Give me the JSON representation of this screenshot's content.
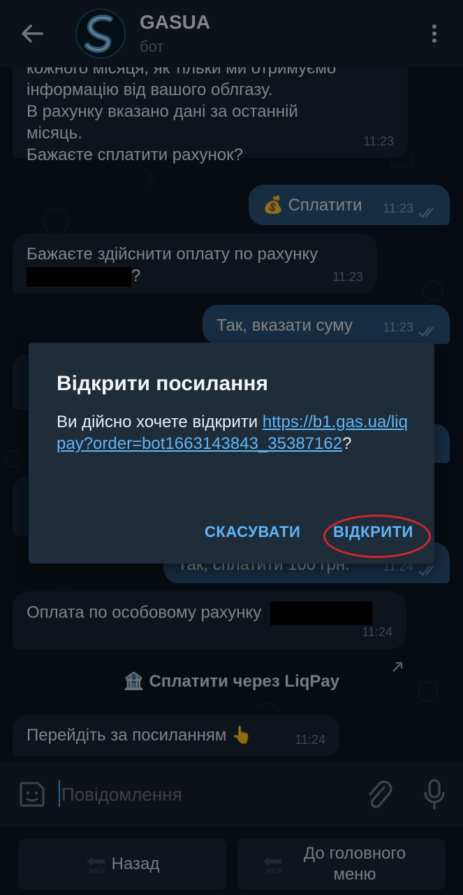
{
  "header": {
    "title": "GASUA",
    "subtitle": "бот"
  },
  "messages": [
    {
      "text_lines": [
        "кожного місяця, як тільки ми отримуємо",
        "інформацію від вашого облгазу.",
        "В рахунку вказано дані за останній",
        "місяць.",
        "Бажаєте сплатити рахунок?"
      ],
      "time": "11:23"
    },
    {
      "emoji": "💰",
      "text": "Сплатити",
      "time": "11:23"
    },
    {
      "text": "Бажаєте здійснити оплату по рахунку",
      "suffix": "?",
      "time": "11:23"
    },
    {
      "text": "Так, вказати суму",
      "time": "11:23"
    },
    {
      "text": "Так, сплатити 100 грн.",
      "time": "11:24"
    },
    {
      "text": "Оплата по особовому рахунку",
      "time": "11:24"
    },
    {
      "text": "Перейдіть за посиланням",
      "emoji": "👆",
      "time": "11:24"
    }
  ],
  "inline_button": {
    "emoji": "🏦",
    "label": "Сплатити через LiqPay"
  },
  "dialog": {
    "title": "Відкрити посилання",
    "question": "Ви дійсно хочете відкрити ",
    "link": "https://b1.gas.ua/liqpay?order=bot1663143843_35387162",
    "question_end": "?",
    "cancel": "СКАСУВАТИ",
    "open": "ВІДКРИТИ"
  },
  "composer": {
    "placeholder": "Повідомлення"
  },
  "keyboard": {
    "back": "Назад",
    "home": "До головного меню",
    "back_icon_text": "BACK"
  },
  "colors": {
    "header_bg": "#17212b",
    "chat_bg": "#0e1621",
    "incoming": "#182533",
    "outgoing": "#2b5278",
    "accent": "#5eb5f7",
    "highlight_circle": "#d8262b"
  }
}
